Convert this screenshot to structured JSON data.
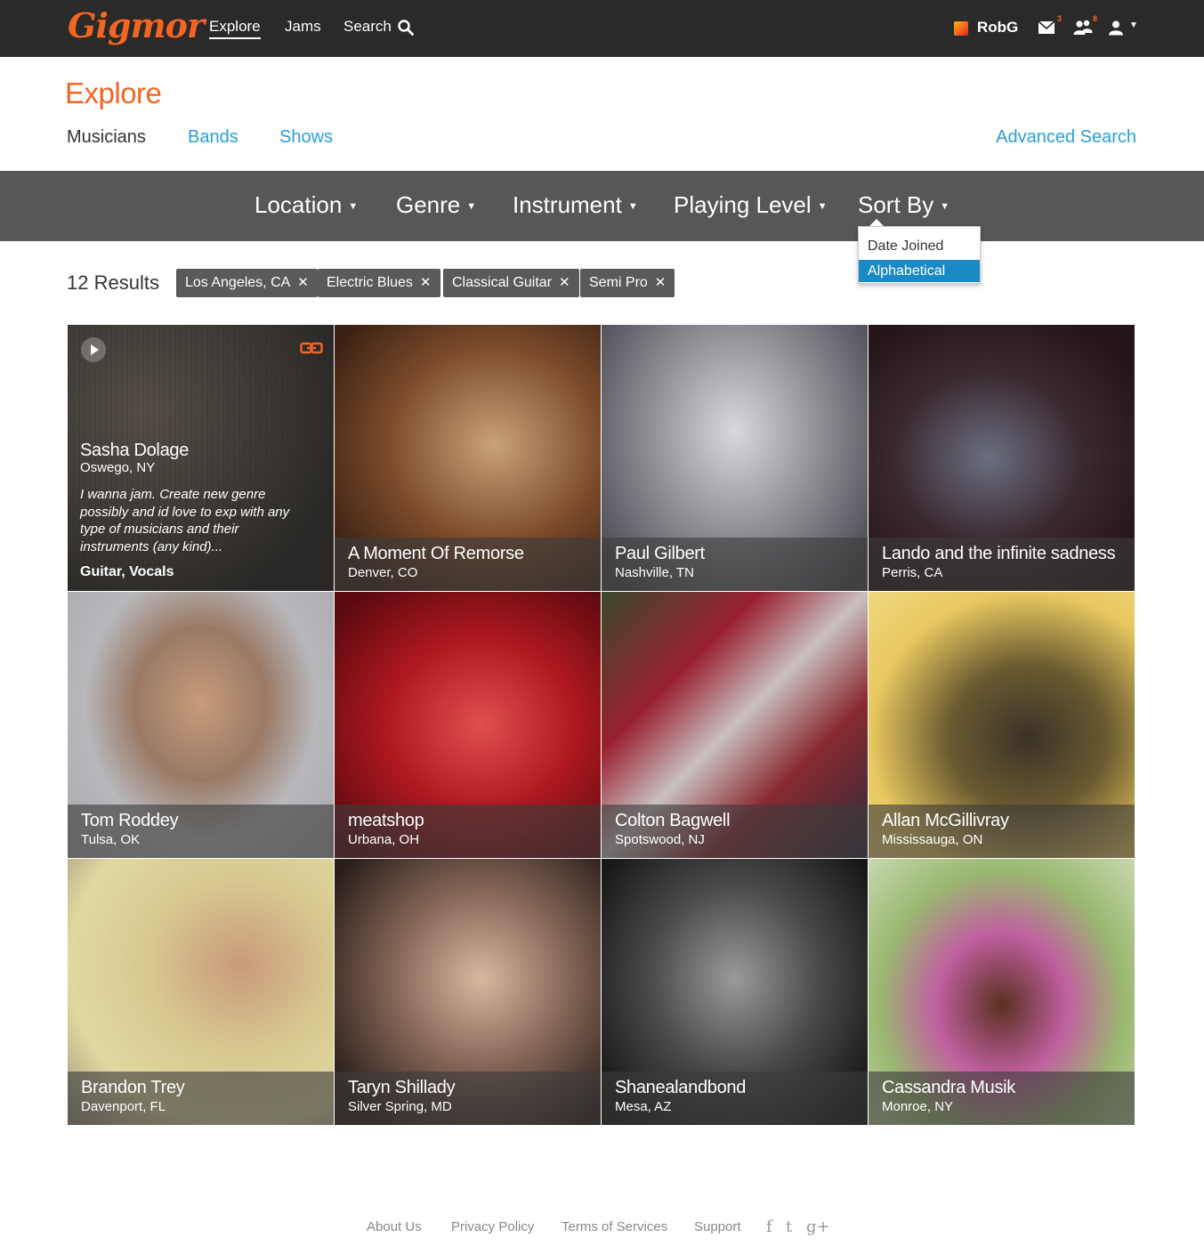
{
  "brand": {
    "logo_text": "Gigmor",
    "accent": "#f26522"
  },
  "nav": {
    "explore": "Explore",
    "jams": "Jams",
    "search": "Search",
    "user_name": "RobG",
    "mail_count": "3",
    "friends_count": "8"
  },
  "header": {
    "title": "Explore",
    "tabs": [
      "Musicians",
      "Bands",
      "Shows"
    ],
    "advanced_search": "Advanced Search"
  },
  "filters": {
    "location": "Location",
    "genre": "Genre",
    "instrument": "Instrument",
    "playing_level": "Playing Level",
    "sort_by": "Sort By",
    "sort_options": [
      "Date Joined",
      "Alphabetical"
    ],
    "sort_selected": "Alphabetical"
  },
  "results": {
    "count_label": "12 Results",
    "chips": [
      "Los Angeles, CA",
      "Electric Blues",
      "Classical Guitar",
      "Semi Pro"
    ],
    "remove_glyph": "✕"
  },
  "musicians": [
    {
      "name": "Sasha Dolage",
      "location": "Oswego, NY",
      "bio": "I wanna jam. Create new genre possibly and id love to exp with any type of musicians and their instruments (any kind)...",
      "instruments": "Guitar, Vocals"
    },
    {
      "name": "A Moment Of Remorse",
      "location": "Denver, CO"
    },
    {
      "name": "Paul Gilbert",
      "location": "Nashville, TN"
    },
    {
      "name": "Lando and the infinite sadness",
      "location": "Perris, CA"
    },
    {
      "name": "Tom Roddey",
      "location": "Tulsa, OK"
    },
    {
      "name": "meatshop",
      "location": "Urbana, OH"
    },
    {
      "name": "Colton Bagwell",
      "location": "Spotswood, NJ"
    },
    {
      "name": "Allan McGillivray",
      "location": "Mississauga, ON"
    },
    {
      "name": "Brandon Trey",
      "location": "Davenport, FL"
    },
    {
      "name": "Taryn Shillady",
      "location": "Silver Spring, MD"
    },
    {
      "name": "Shanealandbond",
      "location": "Mesa, AZ"
    },
    {
      "name": "Cassandra Musik",
      "location": "Monroe, NY"
    }
  ],
  "footer": {
    "links": [
      "About Us",
      "Privacy Policy",
      "Terms of Services",
      "Support"
    ],
    "social": [
      "f",
      "t",
      "g+"
    ]
  }
}
